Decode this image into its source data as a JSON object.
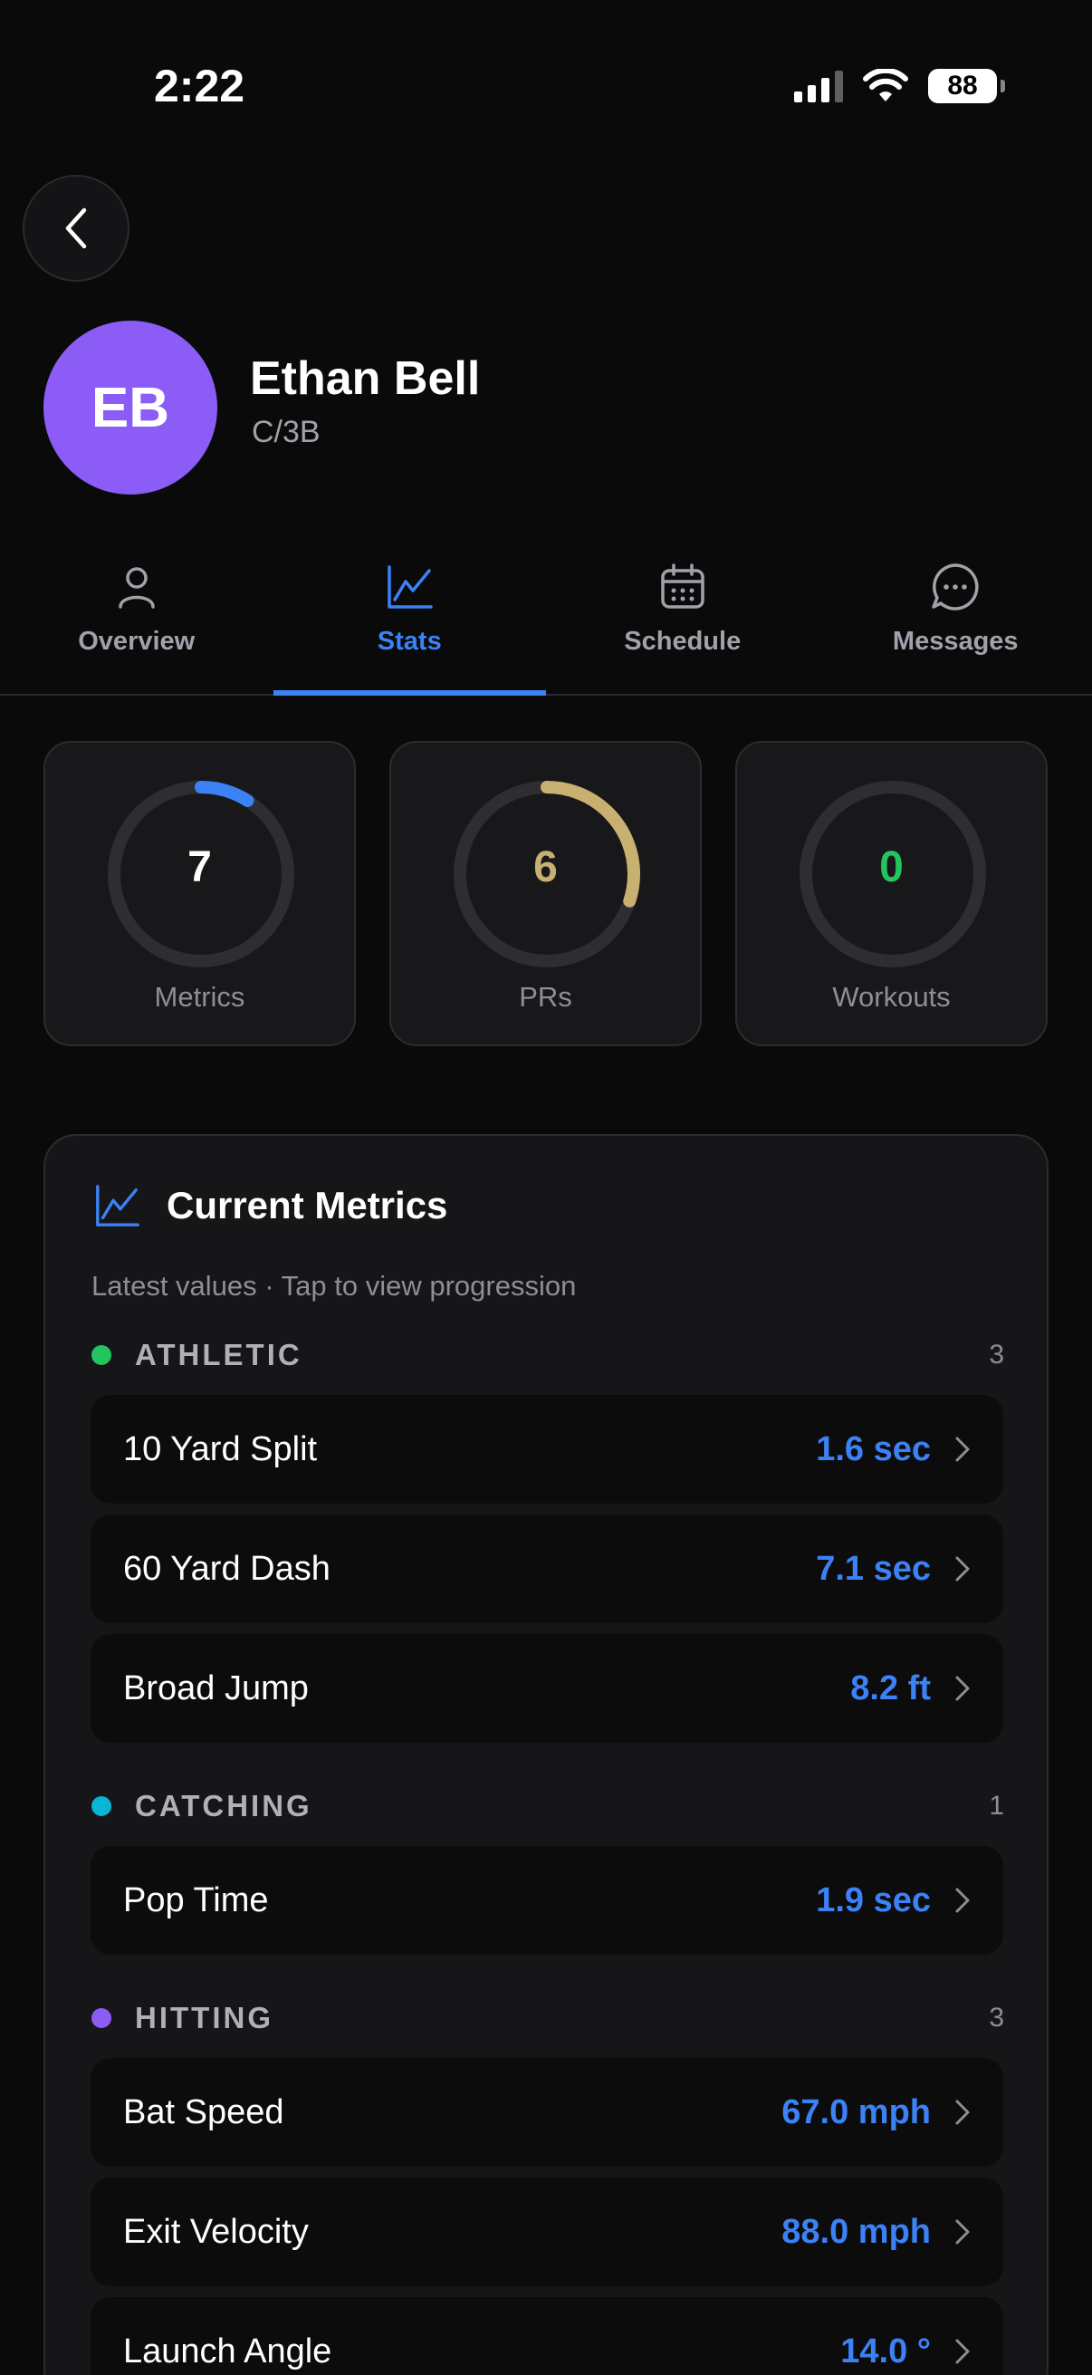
{
  "status_bar": {
    "time": "2:22",
    "battery": "88"
  },
  "profile": {
    "initials": "EB",
    "name": "Ethan Bell",
    "position": "C/3B",
    "avatar_color": "#8b5cf6"
  },
  "tabs": [
    {
      "label": "Overview",
      "icon": "person-icon",
      "active": false
    },
    {
      "label": "Stats",
      "icon": "chart-line-icon",
      "active": true
    },
    {
      "label": "Schedule",
      "icon": "calendar-icon",
      "active": false
    },
    {
      "label": "Messages",
      "icon": "message-bubble-icon",
      "active": false
    }
  ],
  "summary": [
    {
      "value": "7",
      "label": "Metrics",
      "color": "#3b82f6",
      "ring_fraction": 0.09
    },
    {
      "value": "6",
      "label": "PRs",
      "color": "#c8b070",
      "ring_fraction": 0.3
    },
    {
      "value": "0",
      "label": "Workouts",
      "color": "#22c55e",
      "ring_fraction": 0
    }
  ],
  "metrics_panel": {
    "title": "Current Metrics",
    "subtitle": "Latest values · Tap to view progression",
    "groups": [
      {
        "name": "ATHLETIC",
        "count": "3",
        "color": "#22c55e",
        "items": [
          {
            "name": "10 Yard Split",
            "value": "1.6 sec"
          },
          {
            "name": "60 Yard Dash",
            "value": "7.1 sec"
          },
          {
            "name": "Broad Jump",
            "value": "8.2 ft"
          }
        ]
      },
      {
        "name": "CATCHING",
        "count": "1",
        "color": "#06b6d4",
        "items": [
          {
            "name": "Pop Time",
            "value": "1.9 sec"
          }
        ]
      },
      {
        "name": "HITTING",
        "count": "3",
        "color": "#8b5cf6",
        "items": [
          {
            "name": "Bat Speed",
            "value": "67.0 mph"
          },
          {
            "name": "Exit Velocity",
            "value": "88.0 mph"
          },
          {
            "name": "Launch Angle",
            "value": "14.0 °"
          }
        ]
      }
    ]
  },
  "colors": {
    "accent": "#3b82f6",
    "background": "#0a0a0b"
  }
}
